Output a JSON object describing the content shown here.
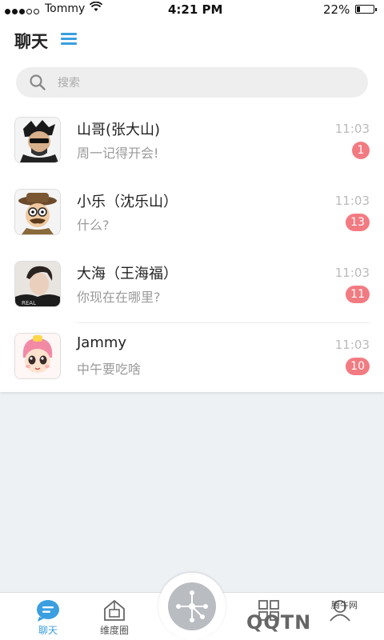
{
  "status_bar": {
    "carrier": "Tommy",
    "time": "4:21 PM",
    "battery": "22%"
  },
  "header": {
    "title": "聊天"
  },
  "search": {
    "placeholder": "搜索"
  },
  "chats": [
    {
      "name": "山哥(张大山)",
      "preview": "周一记得开会!",
      "time": "11:03",
      "badge": "1"
    },
    {
      "name": "小乐（沈乐山）",
      "preview": "什么?",
      "time": "11:03",
      "badge": "13"
    },
    {
      "name": "大海（王海福）",
      "preview": "你现在在哪里?",
      "time": "11:03",
      "badge": "11"
    },
    {
      "name": "Jammy",
      "preview": "中午要吃啥",
      "time": "11:03",
      "badge": "10"
    }
  ],
  "tabs": [
    {
      "label": "聊天",
      "icon": "chat-bubble-icon",
      "active": true
    },
    {
      "label": "维度圈",
      "icon": "circle-icon",
      "active": false
    },
    {
      "label": "",
      "icon": "grid-icon",
      "active": false
    },
    {
      "label": "",
      "icon": "profile-icon",
      "active": false
    }
  ],
  "watermark": {
    "text": "QQTN",
    "cn": "腾牛网"
  },
  "colors": {
    "accent": "#3a9fe0",
    "badge": "#f27b82",
    "background": "#eef1f4"
  }
}
